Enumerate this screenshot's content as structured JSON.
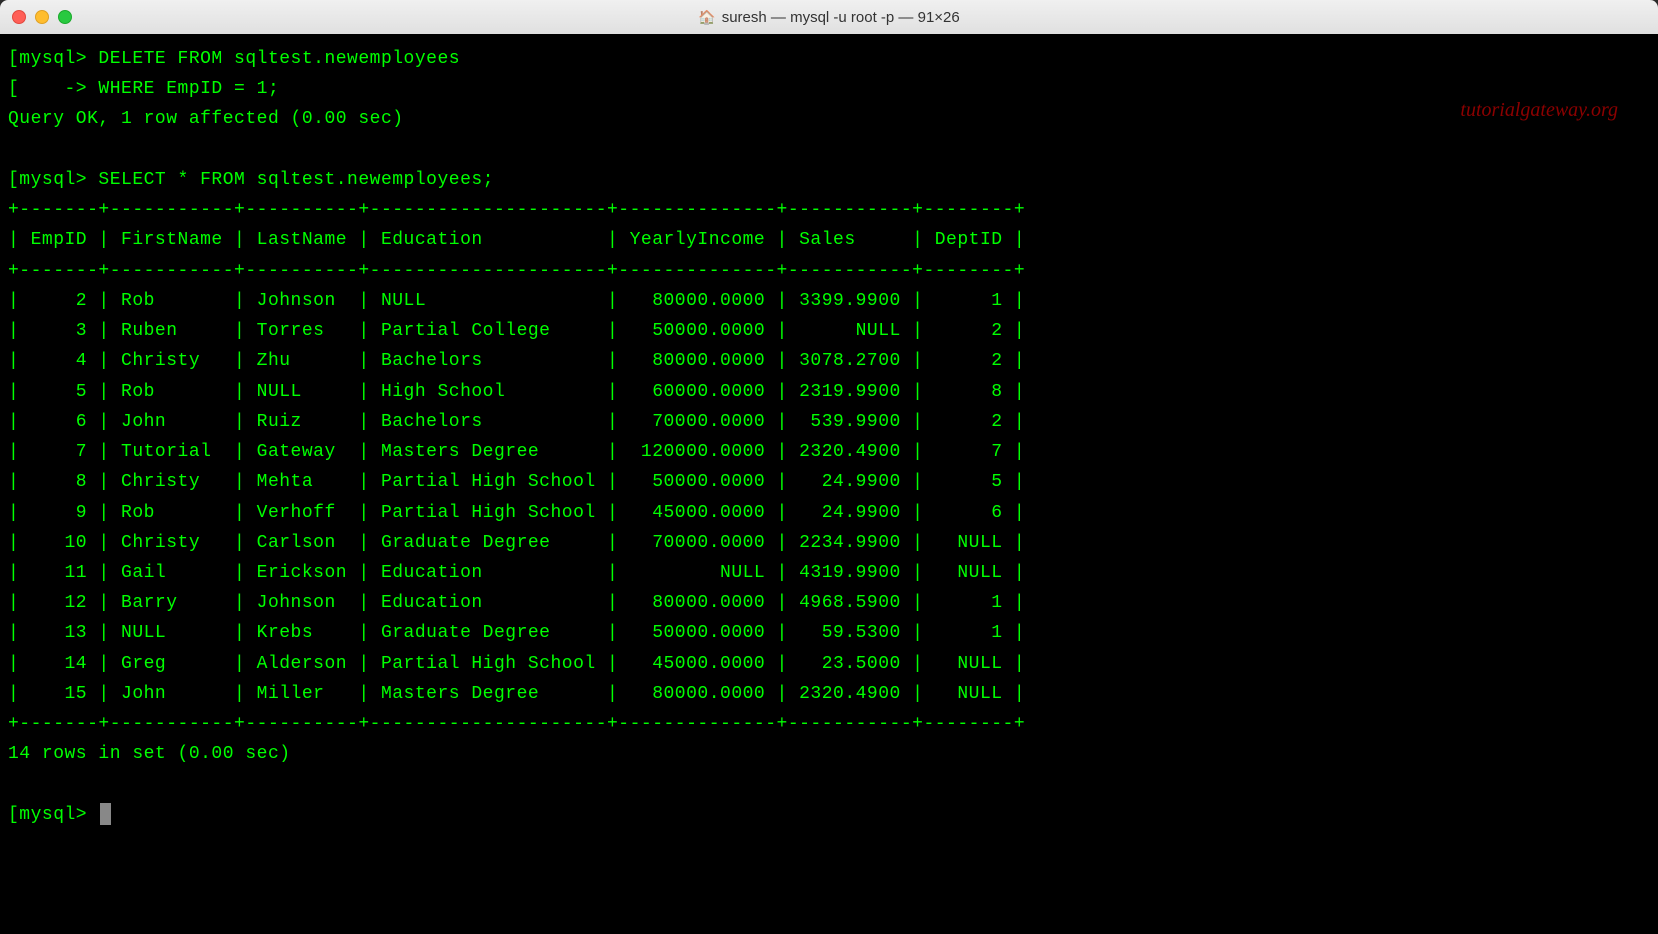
{
  "window": {
    "title": "suresh — mysql -u root -p — 91×26"
  },
  "watermark": "tutorialgateway.org",
  "terminal": {
    "prompt1": "mysql>",
    "prompt_cont": "    ->",
    "delete_stmt1": "DELETE FROM sqltest.newemployees",
    "delete_stmt2": "WHERE EmpID = 1;",
    "query_ok": "Query OK, 1 row affected (0.00 sec)",
    "select_stmt": "SELECT * FROM sqltest.newemployees;",
    "rows_msg": "14 rows in set (0.00 sec)",
    "final_prompt": "mysql>"
  },
  "table": {
    "headers": [
      "EmpID",
      "FirstName",
      "LastName",
      "Education",
      "YearlyIncome",
      "Sales",
      "DeptID"
    ],
    "rows": [
      {
        "EmpID": "2",
        "FirstName": "Rob",
        "LastName": "Johnson",
        "Education": "NULL",
        "YearlyIncome": "80000.0000",
        "Sales": "3399.9900",
        "DeptID": "1"
      },
      {
        "EmpID": "3",
        "FirstName": "Ruben",
        "LastName": "Torres",
        "Education": "Partial College",
        "YearlyIncome": "50000.0000",
        "Sales": "NULL",
        "DeptID": "2"
      },
      {
        "EmpID": "4",
        "FirstName": "Christy",
        "LastName": "Zhu",
        "Education": "Bachelors",
        "YearlyIncome": "80000.0000",
        "Sales": "3078.2700",
        "DeptID": "2"
      },
      {
        "EmpID": "5",
        "FirstName": "Rob",
        "LastName": "NULL",
        "Education": "High School",
        "YearlyIncome": "60000.0000",
        "Sales": "2319.9900",
        "DeptID": "8"
      },
      {
        "EmpID": "6",
        "FirstName": "John",
        "LastName": "Ruiz",
        "Education": "Bachelors",
        "YearlyIncome": "70000.0000",
        "Sales": "539.9900",
        "DeptID": "2"
      },
      {
        "EmpID": "7",
        "FirstName": "Tutorial",
        "LastName": "Gateway",
        "Education": "Masters Degree",
        "YearlyIncome": "120000.0000",
        "Sales": "2320.4900",
        "DeptID": "7"
      },
      {
        "EmpID": "8",
        "FirstName": "Christy",
        "LastName": "Mehta",
        "Education": "Partial High School",
        "YearlyIncome": "50000.0000",
        "Sales": "24.9900",
        "DeptID": "5"
      },
      {
        "EmpID": "9",
        "FirstName": "Rob",
        "LastName": "Verhoff",
        "Education": "Partial High School",
        "YearlyIncome": "45000.0000",
        "Sales": "24.9900",
        "DeptID": "6"
      },
      {
        "EmpID": "10",
        "FirstName": "Christy",
        "LastName": "Carlson",
        "Education": "Graduate Degree",
        "YearlyIncome": "70000.0000",
        "Sales": "2234.9900",
        "DeptID": "NULL"
      },
      {
        "EmpID": "11",
        "FirstName": "Gail",
        "LastName": "Erickson",
        "Education": "Education",
        "YearlyIncome": "NULL",
        "Sales": "4319.9900",
        "DeptID": "NULL"
      },
      {
        "EmpID": "12",
        "FirstName": "Barry",
        "LastName": "Johnson",
        "Education": "Education",
        "YearlyIncome": "80000.0000",
        "Sales": "4968.5900",
        "DeptID": "1"
      },
      {
        "EmpID": "13",
        "FirstName": "NULL",
        "LastName": "Krebs",
        "Education": "Graduate Degree",
        "YearlyIncome": "50000.0000",
        "Sales": "59.5300",
        "DeptID": "1"
      },
      {
        "EmpID": "14",
        "FirstName": "Greg",
        "LastName": "Alderson",
        "Education": "Partial High School",
        "YearlyIncome": "45000.0000",
        "Sales": "23.5000",
        "DeptID": "NULL"
      },
      {
        "EmpID": "15",
        "FirstName": "John",
        "LastName": "Miller",
        "Education": "Masters Degree",
        "YearlyIncome": "80000.0000",
        "Sales": "2320.4900",
        "DeptID": "NULL"
      }
    ]
  }
}
